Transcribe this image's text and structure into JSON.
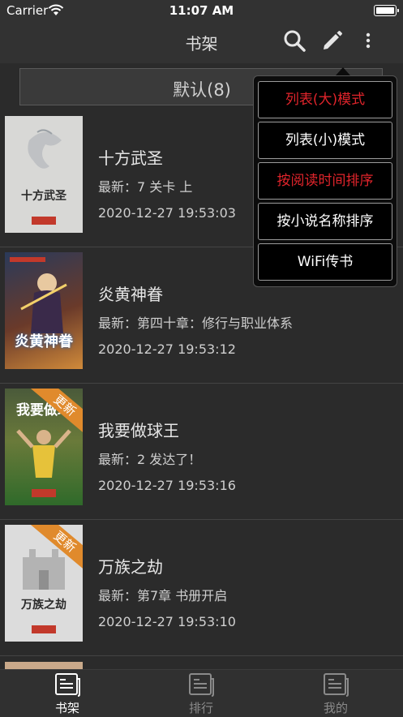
{
  "status": {
    "carrier": "Carrier",
    "time": "11:07 AM"
  },
  "nav": {
    "title": "书架",
    "icons": [
      "search-icon",
      "edit-icon",
      "more-vertical-icon"
    ]
  },
  "segment": {
    "label": "默认(8)"
  },
  "books": [
    {
      "title": "十方武圣",
      "latest": "最新：7 关卡 上",
      "time": "2020-12-27 19:53:03",
      "cover_text": "十方武圣",
      "badge": ""
    },
    {
      "title": "炎黄神眷",
      "latest": "最新：第四十章：修行与职业体系",
      "time": "2020-12-27 19:53:12",
      "cover_text": "炎黄神眷",
      "badge": ""
    },
    {
      "title": "我要做球王",
      "latest": "最新：2 发达了！",
      "time": "2020-12-27 19:53:16",
      "cover_text": "我要做球",
      "badge": "更新"
    },
    {
      "title": "万族之劫",
      "latest": "最新：第7章 书册开启",
      "time": "2020-12-27 19:53:10",
      "cover_text": "万族之劫",
      "badge": "更新"
    }
  ],
  "menu": [
    {
      "label": "列表(大)模式",
      "color": "#e0242b"
    },
    {
      "label": "列表(小)模式",
      "color": "#ffffff"
    },
    {
      "label": "按阅读时间排序",
      "color": "#e0242b"
    },
    {
      "label": "按小说名称排序",
      "color": "#ffffff"
    },
    {
      "label": "WiFi传书",
      "color": "#ffffff"
    }
  ],
  "tabs": [
    {
      "label": "书架",
      "active": true
    },
    {
      "label": "排行",
      "active": false
    },
    {
      "label": "我的",
      "active": false
    }
  ],
  "colors": {
    "active_tab": "#ffffff",
    "inactive_tab": "#8a8a8a",
    "menu_highlight": "#e0242b",
    "badge": "#e08a2c"
  }
}
